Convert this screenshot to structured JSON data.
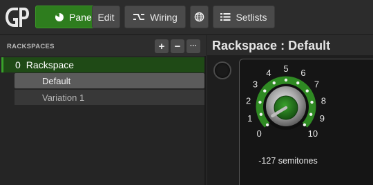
{
  "toolbar": {
    "panels_label": "Panels",
    "edit_label": "Edit",
    "wiring_label": "Wiring",
    "setlists_label": "Setlists"
  },
  "rackspaces": {
    "header": "RACKSPACES",
    "add_label": "+",
    "remove_label": "−",
    "more_label": "···",
    "items": [
      {
        "index": "0",
        "name": "Rackspace"
      }
    ],
    "variations": [
      {
        "name": "Default",
        "selected": true
      },
      {
        "name": "Variation 1",
        "selected": false
      }
    ]
  },
  "main": {
    "title": "Rackspace : Default",
    "knob": {
      "scale_labels": [
        "0",
        "1",
        "2",
        "3",
        "4",
        "5",
        "6",
        "7",
        "8",
        "9",
        "10"
      ],
      "value_text": "-127 semitones",
      "value_fraction": 0.0
    }
  },
  "colors": {
    "accent": "#2e7d1e",
    "knob_ring": "#2f8a23",
    "knob_cap": "#1f6a1a"
  }
}
